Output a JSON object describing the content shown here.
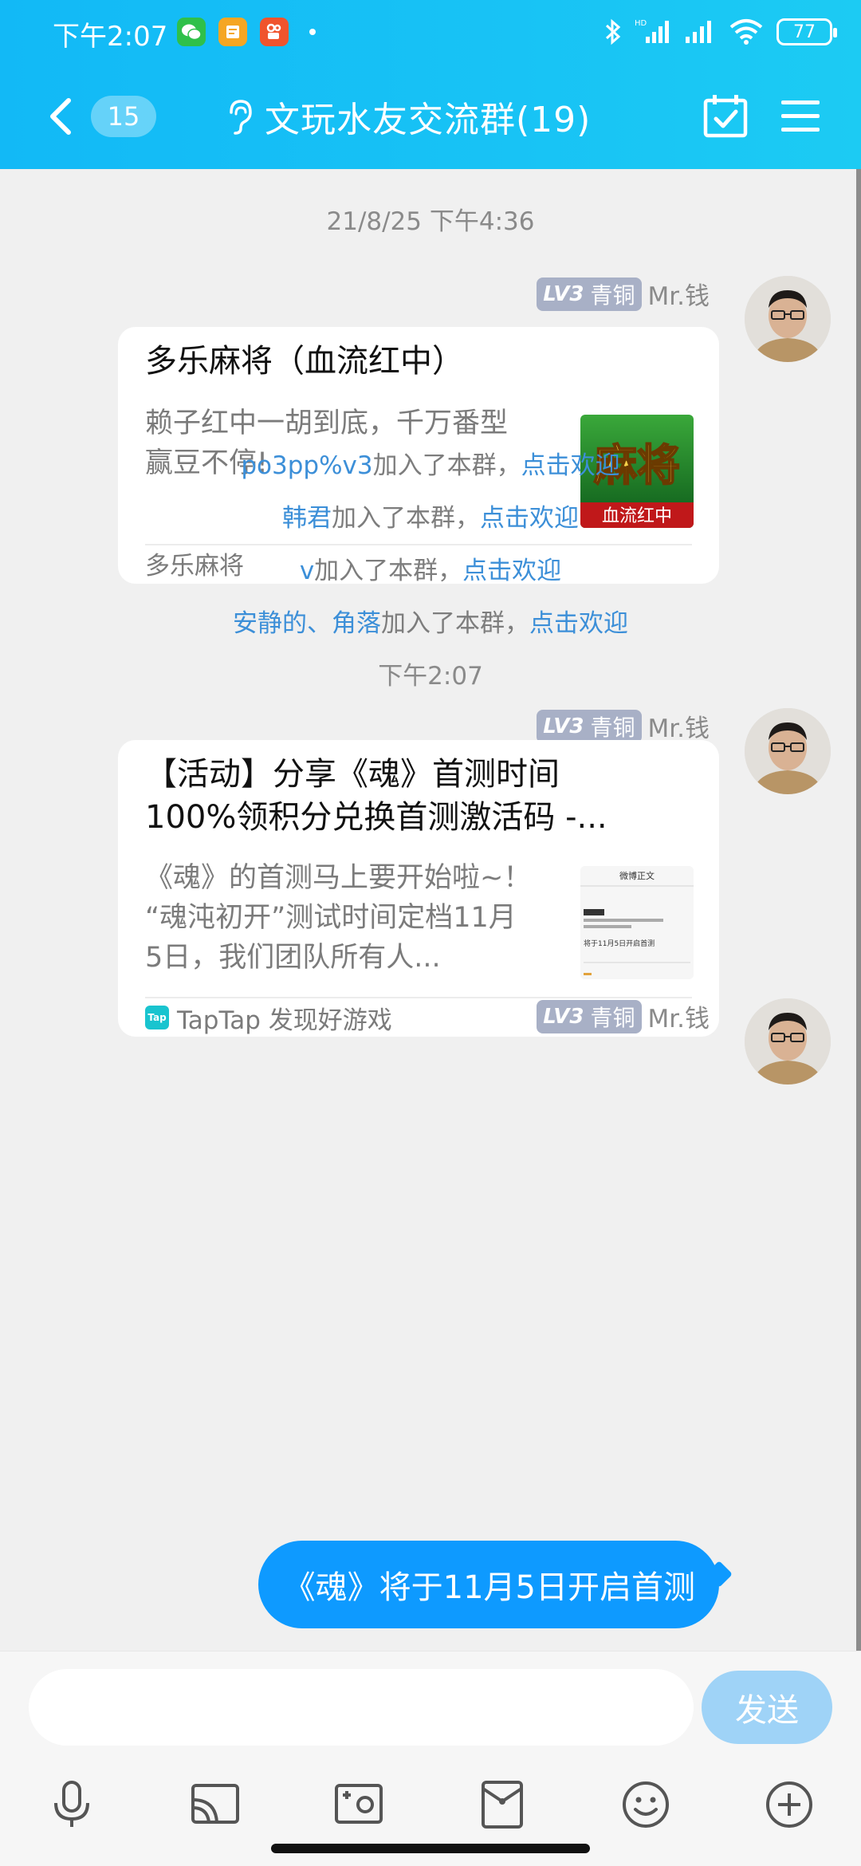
{
  "status": {
    "time": "下午2:07",
    "battery": "77"
  },
  "nav": {
    "unread": "15",
    "title": "文玩水友交流群(19)"
  },
  "messages": {
    "time1": "21/8/25 下午4:36",
    "sender1": {
      "level": "LV3",
      "rank": "青铜",
      "name": "Mr.钱"
    },
    "card1": {
      "title": "多乐麻将（血流红中）",
      "desc_line1": "赖子红中一胡到底，千万番型",
      "desc_line2": "赢豆不停!",
      "thumb_text_top": "麻将",
      "thumb_text_bottom": "血流红中",
      "source": "多乐麻将"
    },
    "system": [
      {
        "name": "po3pp%v3",
        "text": "加入了本群，",
        "link": "点击欢迎"
      },
      {
        "name": "韩君",
        "text": "加入了本群，",
        "link": "点击欢迎"
      },
      {
        "name": "v",
        "text": "加入了本群，",
        "link": "点击欢迎"
      },
      {
        "name": "安静的、角落",
        "text": "加入了本群，",
        "link": "点击欢迎"
      }
    ],
    "time2": "下午2:07",
    "sender2": {
      "level": "LV3",
      "rank": "青铜",
      "name": "Mr.钱"
    },
    "card2": {
      "title_line1": "【活动】分享《魂》首测时间",
      "title_line2": "100%领积分兑换首测激活码 -...",
      "desc_line1": "《魂》的首测马上要开始啦~！",
      "desc_line2": "“魂沌初开”测试时间定档11月",
      "desc_line3": "5日，我们团队所有人...",
      "thumb_header": "微博正文",
      "thumb_line": "将于11月5日开启首测",
      "source_logo": "Tap",
      "source": "TapTap 发现好游戏"
    },
    "sender3": {
      "level": "LV3",
      "rank": "青铜",
      "name": "Mr.钱"
    },
    "bubble": "《魂》将于11月5日开启首测"
  },
  "input": {
    "placeholder": "",
    "send_label": "发送"
  }
}
